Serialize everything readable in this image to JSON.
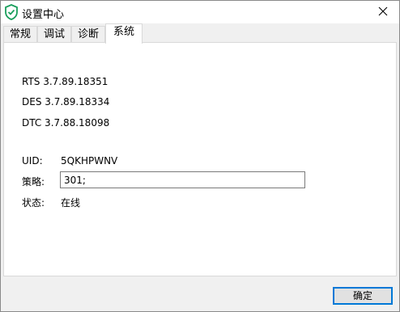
{
  "window": {
    "title": "设置中心",
    "icon": "shield-check-icon",
    "close_icon": "close-icon"
  },
  "tabs": [
    {
      "label": "常规",
      "active": false
    },
    {
      "label": "调试",
      "active": false
    },
    {
      "label": "诊断",
      "active": false
    },
    {
      "label": "系统",
      "active": true
    }
  ],
  "system": {
    "versions": [
      "RTS 3.7.89.18351",
      "DES 3.7.89.18334",
      "DTC 3.7.88.18098"
    ],
    "uid_label": "UID:",
    "uid_value": "5QKHPWNV",
    "strategy_label": "策略:",
    "strategy_value": "301;",
    "status_label": "状态:",
    "status_value": "在线"
  },
  "footer": {
    "ok_label": "确定"
  },
  "colors": {
    "accent": "#0078d7",
    "shield": "#1a9e5c"
  }
}
